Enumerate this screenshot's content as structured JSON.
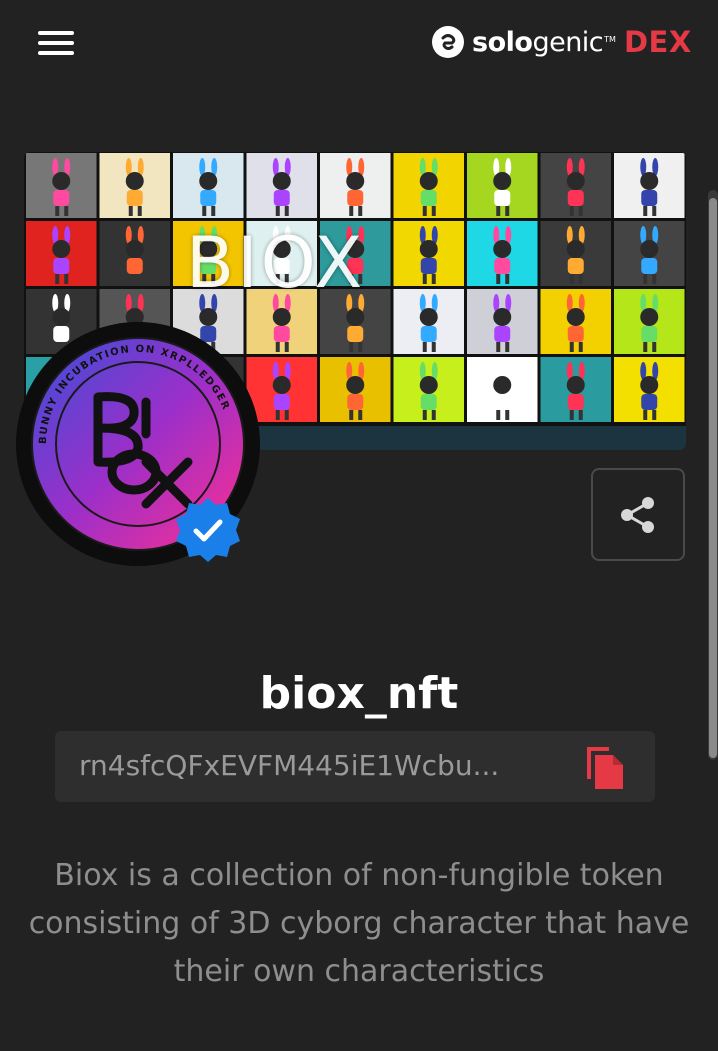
{
  "header": {
    "logo_bold": "solo",
    "logo_light": "genic",
    "logo_tm": "TM",
    "logo_dex": "DEX",
    "menu_icon": "hamburger-icon"
  },
  "banner": {
    "title": "BIOX"
  },
  "profile": {
    "avatar_ring_text": "BUNNY INCUBATION ON XRPLLEDGER",
    "avatar_letters": "BIOX",
    "verified_icon": "verified-badge-icon",
    "share_icon": "share-icon",
    "username": "biox_nft",
    "address": "rn4sfcQFxEVFM445iE1Wcbu...",
    "copy_icon": "copy-icon",
    "description": "Biox is a collection of non-fungible token consisting of 3D cyborg character that have their own characteristics"
  },
  "colors": {
    "background": "#222222",
    "accent_red": "#e53946",
    "verified_blue": "#1a7fe8",
    "text_muted": "#8e8e8e"
  }
}
